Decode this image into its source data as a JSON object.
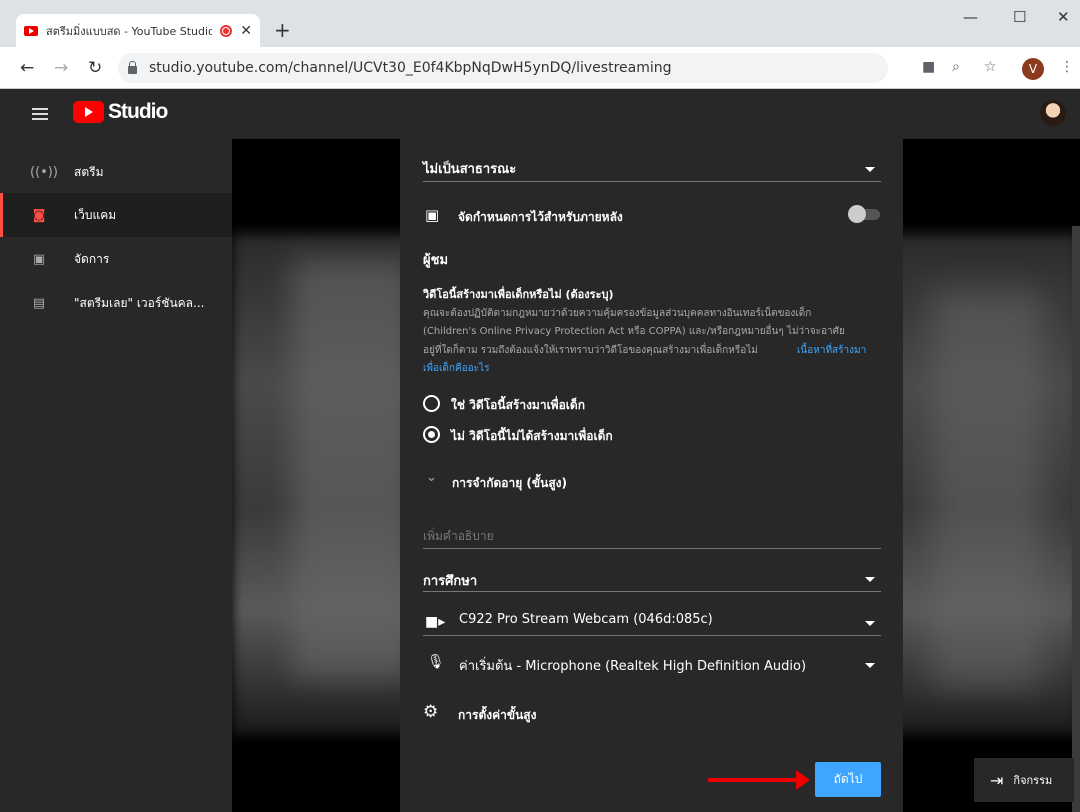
{
  "browser": {
    "tab_title": "สตรีมมิ่งแบบสด - YouTube Studio",
    "tab_close": "✕",
    "new_tab": "+",
    "url": "studio.youtube.com/channel/UCVt30_E0f4KbpNqDwH5ynDQ/livestreaming",
    "profile_initial": "V",
    "window": {
      "minimize": "—",
      "maximize": "☐",
      "close": "✕"
    }
  },
  "studio": {
    "logo_text": "Studio"
  },
  "sidebar": {
    "items": [
      {
        "label": "สตรีม",
        "icon": "stream-icon"
      },
      {
        "label": "เว็บแคม",
        "icon": "camera-icon",
        "active": true
      },
      {
        "label": "จัดการ",
        "icon": "calendar-icon"
      },
      {
        "label": "\"สตรีมเลย\" เวอร์ชันคล...",
        "icon": "legacy-icon"
      }
    ]
  },
  "form": {
    "privacy_value": "ไม่เป็นสาธารณะ",
    "schedule_label": "จัดกำหนดการไว้สำหรับภายหลัง",
    "schedule_on": false,
    "audience_heading": "ผู้ชม",
    "kids_question": "วิดีโอนี้สร้างมาเพื่อเด็กหรือไม่ (ต้องระบุ)",
    "kids_desc_1": "คุณจะต้องปฏิบัติตามกฎหมายว่าด้วยความคุ้มครองข้อมูลส่วนบุคคลทางอินเทอร์เน็ตของเด็ก",
    "kids_desc_2": "(Children's Online Privacy Protection Act หรือ COPPA) และ/หรือกฎหมายอื่นๆ ไม่ว่าจะอาศัย",
    "kids_desc_3": "อยู่ที่ใดก็ตาม รวมถึงต้องแจ้งให้เราทราบว่าวิดีโอของคุณสร้างมาเพื่อเด็กหรือไม่",
    "kids_link_1": "เนื้อหาที่สร้างมา",
    "kids_link_2": "เพื่อเด็กคืออะไร",
    "option_yes": "ใช่ วิดีโอนี้สร้างมาเพื่อเด็ก",
    "option_no": "ไม่ วิดีโอนี้ไม่ได้สร้างมาเพื่อเด็ก",
    "selected_option": "no",
    "age_restriction": "การจำกัดอายุ (ขั้นสูง)",
    "description_placeholder": "เพิ่มคำอธิบาย",
    "category_value": "การศึกษา",
    "camera_value": "C922 Pro Stream Webcam (046d:085c)",
    "mic_value": "ค่าเริ่มต้น - Microphone (Realtek High Definition Audio)",
    "advanced_settings": "การตั้งค่าขั้นสูง",
    "next_button": "ถัดไป"
  },
  "activity": {
    "label": "กิจกรรม"
  },
  "colors": {
    "accent": "#3ea6ff",
    "brand_red": "#ff0000",
    "annotation_arrow": "#e00000"
  }
}
